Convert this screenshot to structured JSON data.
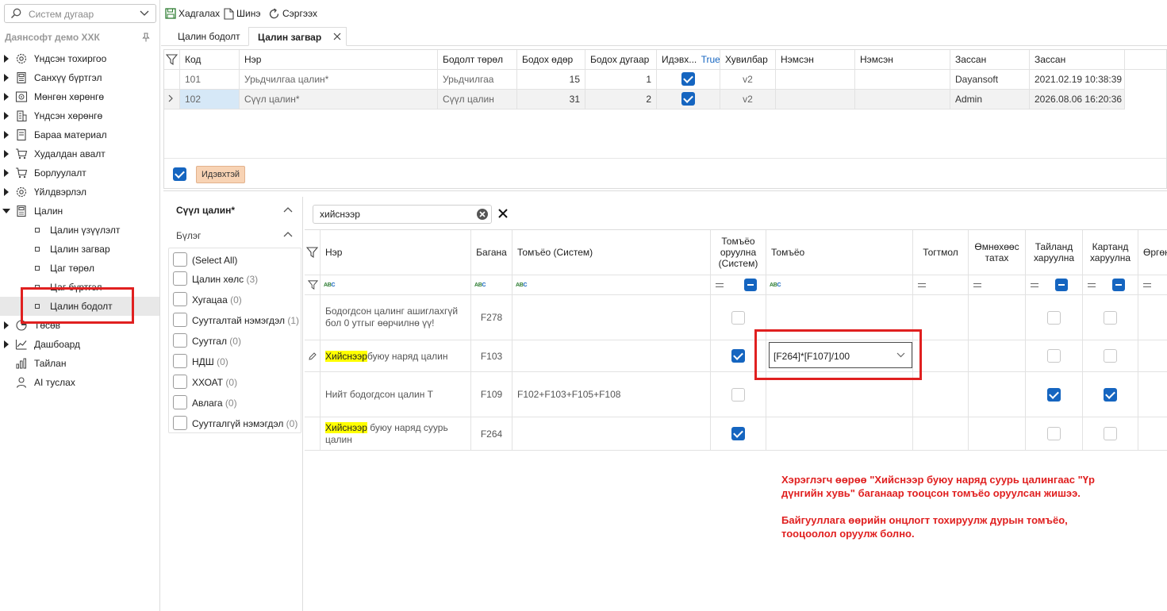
{
  "sidebar": {
    "search_placeholder": "Систем дугаар",
    "company": "Даянсофт демо ХХК",
    "items": [
      {
        "label": "Үндсэн тохиргоо",
        "icon": "gear-icon"
      },
      {
        "label": "Санхүү бүртгэл",
        "icon": "calculator-icon"
      },
      {
        "label": "Мөнгөн хөрөнгө",
        "icon": "safe-icon"
      },
      {
        "label": "Үндсэн хөрөнгө",
        "icon": "building-icon"
      },
      {
        "label": "Бараа материал",
        "icon": "box-icon"
      },
      {
        "label": "Худалдан авалт",
        "icon": "cart-icon"
      },
      {
        "label": "Борлуулалт",
        "icon": "cart-icon"
      },
      {
        "label": "Үйлдвэрлэл",
        "icon": "factory-icon"
      },
      {
        "label": "Цалин",
        "icon": "calculator-icon"
      }
    ],
    "sub_items": [
      {
        "label": "Цалин үзүүлэлт"
      },
      {
        "label": "Цалин загвар"
      },
      {
        "label": "Цаг төрөл"
      },
      {
        "label": "Цаг бүртгэл"
      },
      {
        "label": "Цалин бодолт"
      }
    ],
    "items_after": [
      {
        "label": "Төсөв",
        "icon": "budget-icon"
      },
      {
        "label": "Дашбоард",
        "icon": "dashboard-icon"
      },
      {
        "label": "Тайлан",
        "icon": "chart-icon"
      },
      {
        "label": "AI туслах",
        "icon": "ai-assistant-icon"
      }
    ]
  },
  "toolbar": {
    "save_label": "Хадгалах",
    "new_label": "Шинэ",
    "refresh_label": "Сэргээх"
  },
  "tabs": [
    {
      "label": "Цалин бодолт"
    },
    {
      "label": "Цалин загвар"
    }
  ],
  "upper_grid": {
    "headers": [
      "Код",
      "Нэр",
      "Бодолт төрөл",
      "Бодох өдөр",
      "Бодох дугаар",
      "Идэвх...",
      "True",
      "Хувилбар",
      "Нэмсэн",
      "Нэмсэн",
      "Зассан",
      "Зассан"
    ],
    "rows": [
      {
        "code": "101",
        "name": "Урьдчилгаа цалин*",
        "type": "Урьдчилгаа",
        "day": "15",
        "number": "1",
        "active": true,
        "version": "v2",
        "added_by": "",
        "added_at": "",
        "edited_by": "Dayansoft",
        "edited_at": "2021.02.19 10:38:39"
      },
      {
        "code": "102",
        "name": "Сүүл цалин*",
        "type": "Сүүл цалин",
        "day": "31",
        "number": "2",
        "active": true,
        "version": "v2",
        "added_by": "",
        "added_at": "",
        "edited_by": "Admin",
        "edited_at": "2026.08.06 16:20:36"
      }
    ],
    "filter_chip": "Идэвхтэй"
  },
  "groups": {
    "title": "Сүүл цалин*",
    "group_label": "Бүлэг",
    "items": [
      {
        "label": "(Select All)",
        "count": ""
      },
      {
        "label": "Цалин хөлс",
        "count": "(3)"
      },
      {
        "label": "Хугацаа",
        "count": "(0)"
      },
      {
        "label": "Суутгалтай нэмэгдэл",
        "count": "(1)"
      },
      {
        "label": "Суутгал",
        "count": "(0)"
      },
      {
        "label": "НДШ",
        "count": "(0)"
      },
      {
        "label": "ХХОАТ",
        "count": "(0)"
      },
      {
        "label": "Авлага",
        "count": "(0)"
      },
      {
        "label": "Суутгалгүй нэмэгдэл",
        "count": "(0)"
      }
    ]
  },
  "lower": {
    "search_value": "хийснээр",
    "headers": {
      "name": "Нэр",
      "column": "Багана",
      "formula_system": "Томъёо (Систем)",
      "enter_formula_system": "Томъёо оруулна (Систем)",
      "formula": "Томъёо",
      "constant": "Тогтмол",
      "deduct_previous": "Өмнөхөөс татах",
      "show_report": "Тайланд харуулна",
      "show_card": "Картанд харуулна",
      "extra": "Өргөн"
    },
    "rows": [
      {
        "name_pre": "",
        "name_hl": "",
        "name_post": "Бодогдсон цалинг ашиглахгүй бол 0 утгыг өөрчилнө үү!",
        "column": "F278",
        "formula_system": "",
        "enter_sys": false,
        "formula": "",
        "report": false,
        "card": false
      },
      {
        "name_pre": "",
        "name_hl": "Хийснээр",
        "name_post": " буюу наряд цалин",
        "column": "F103",
        "formula_system": "",
        "enter_sys": true,
        "formula": "[F264]*[F107]/100",
        "report": false,
        "card": false
      },
      {
        "name_pre": "",
        "name_hl": "",
        "name_post": "Нийт бодогдсон цалин Т",
        "column": "F109",
        "formula_system": "F102+F103+F105+F108",
        "enter_sys": false,
        "formula": "",
        "report": true,
        "card": true
      },
      {
        "name_pre": "",
        "name_hl": "Хийснээр",
        "name_post": " буюу наряд суурь цалин",
        "column": "F264",
        "formula_system": "",
        "enter_sys": true,
        "formula": "",
        "report": false,
        "card": false
      }
    ]
  },
  "annotation": {
    "line1": "Хэрэглэгч өөрөө \"Хийснээр буюу наряд суурь цалингаас \"Үр дүнгийн хувь\" баганаар тооцсон томъёо оруулсан жишээ.",
    "line2": "Байгууллага өөрийн онцлогт тохируулж дурын томъёо, тооцоолол оруулж болно."
  },
  "colors": {
    "accent": "#1565c0",
    "annotation": "#e02020",
    "highlight": "#ffff00",
    "chip": "#f8d3b4"
  }
}
